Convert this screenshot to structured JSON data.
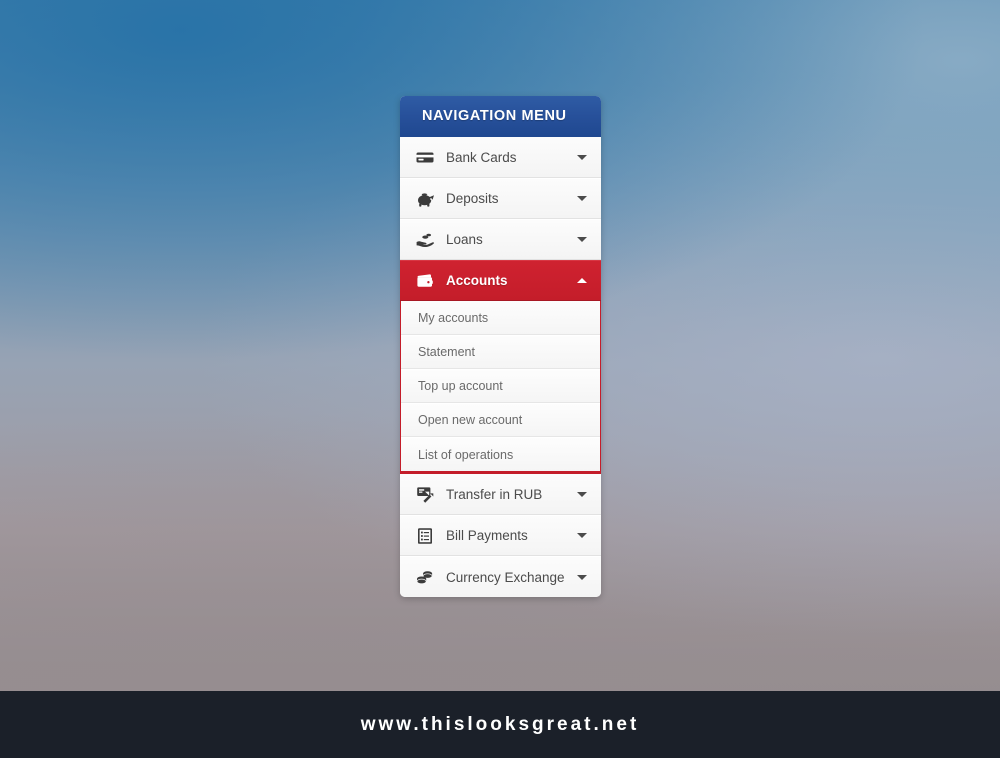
{
  "background": {
    "top_color": "#3a7ba8",
    "bottom_color": "#948d90",
    "accent_blue": "#27509a",
    "accent_red": "#c41d2a"
  },
  "menu": {
    "header": {
      "title": "NAVIGATION MENU",
      "bg_color": "#27509a"
    },
    "items_top": [
      {
        "label": "Bank Cards",
        "icon": "credit-card-icon",
        "caret": "down",
        "active": false
      },
      {
        "label": "Deposits",
        "icon": "piggy-bank-icon",
        "caret": "down",
        "active": false
      },
      {
        "label": "Loans",
        "icon": "hand-coins-icon",
        "caret": "down",
        "active": false
      },
      {
        "label": "Accounts",
        "icon": "wallet-icon",
        "caret": "up",
        "active": true
      }
    ],
    "submenu": [
      {
        "label": "My accounts"
      },
      {
        "label": "Statement"
      },
      {
        "label": "Top up account"
      },
      {
        "label": "Open new account"
      },
      {
        "label": "List of operations"
      }
    ],
    "items_bottom": [
      {
        "label": "Transfer in RUB",
        "icon": "monitor-transfer-icon",
        "caret": "down",
        "active": false
      },
      {
        "label": "Bill Payments",
        "icon": "list-document-icon",
        "caret": "down",
        "active": false
      },
      {
        "label": "Currency Exchange",
        "icon": "coins-stack-icon",
        "caret": "down",
        "active": false
      }
    ]
  },
  "footer": {
    "url": "www.thislooksgreat.net",
    "bg_color": "#1b2029"
  }
}
